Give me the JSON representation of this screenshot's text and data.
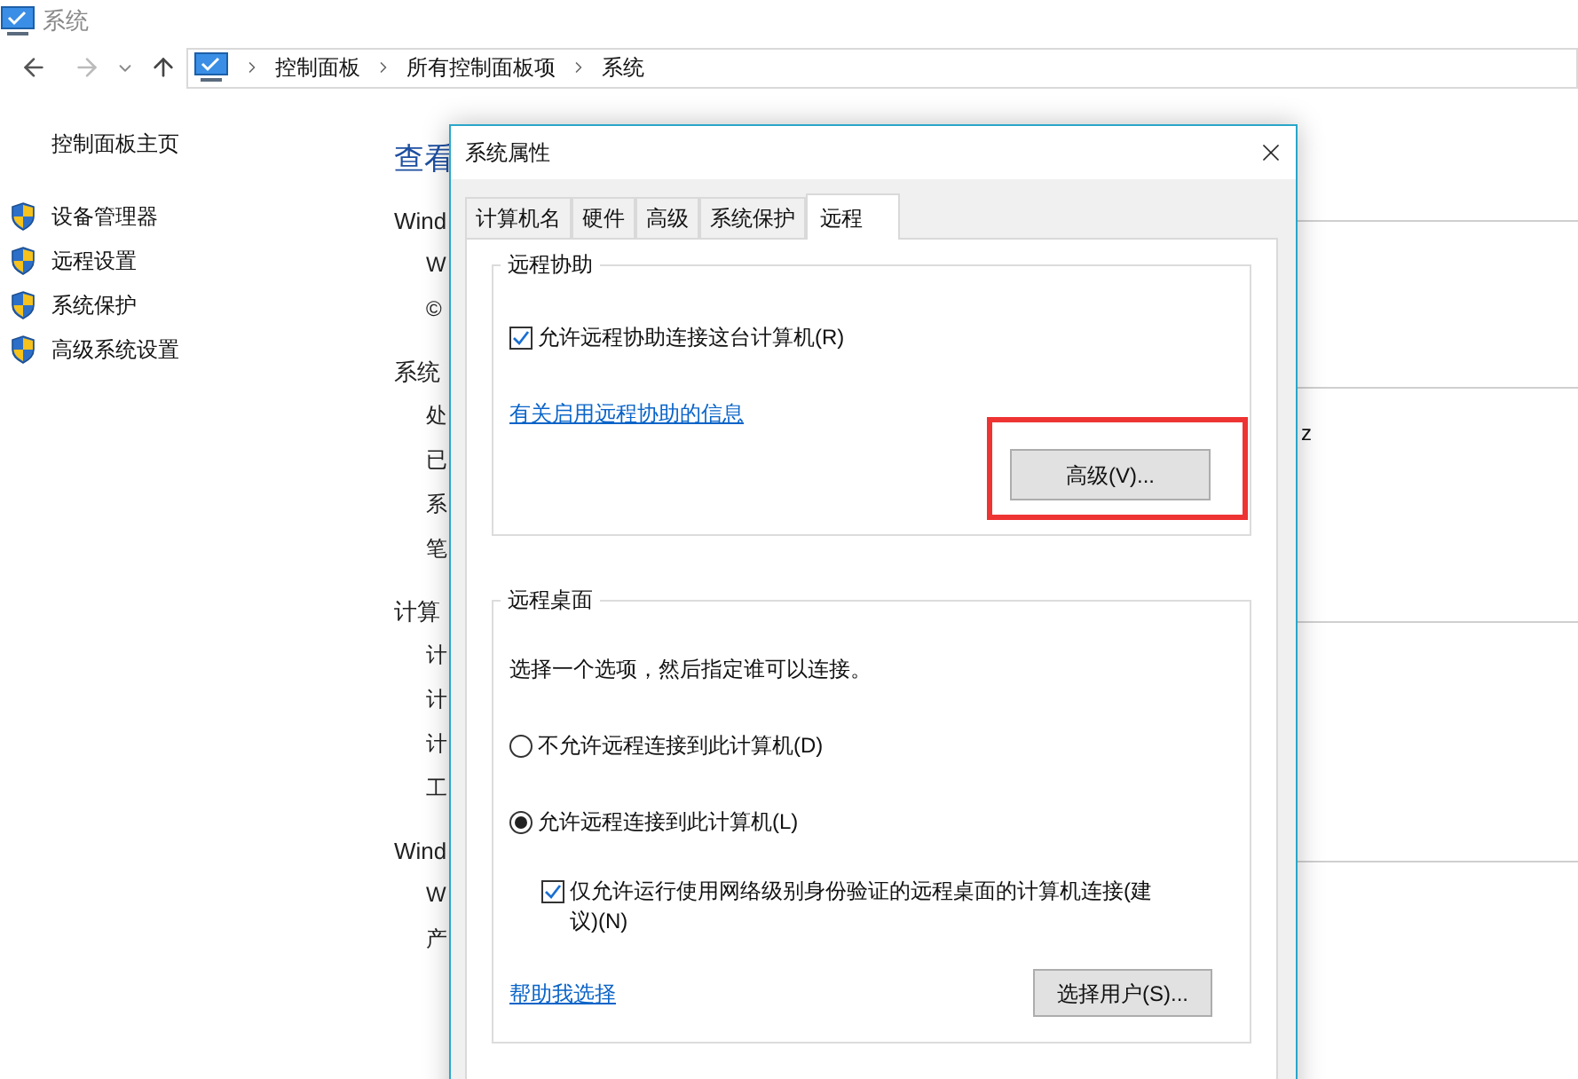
{
  "window": {
    "title": "系统"
  },
  "address_bar": {
    "breadcrumb": [
      "控制面板",
      "所有控制面板项",
      "系统"
    ]
  },
  "sidebar": {
    "home": "控制面板主页",
    "items": [
      "设备管理器",
      "远程设置",
      "系统保护",
      "高级系统设置"
    ]
  },
  "background_text": [
    {
      "text": "查看",
      "kind": "heading"
    },
    {
      "text": "Wind",
      "kind": "section"
    },
    {
      "text": "W",
      "kind": "item"
    },
    {
      "text": "©",
      "kind": "item"
    },
    {
      "text": "系统",
      "kind": "section"
    },
    {
      "text": "处",
      "kind": "item"
    },
    {
      "text": "已",
      "kind": "item"
    },
    {
      "text": "系",
      "kind": "item"
    },
    {
      "text": "笔",
      "kind": "item"
    },
    {
      "text": "计算",
      "kind": "section"
    },
    {
      "text": "计",
      "kind": "item"
    },
    {
      "text": "计",
      "kind": "item"
    },
    {
      "text": "计",
      "kind": "item"
    },
    {
      "text": "工",
      "kind": "item"
    },
    {
      "text": "Wind",
      "kind": "section"
    },
    {
      "text": "W",
      "kind": "item"
    },
    {
      "text": "产",
      "kind": "item"
    }
  ],
  "background_right_text": "z",
  "dialog": {
    "title": "系统属性",
    "tabs": [
      {
        "label": "计算机名",
        "selected": false
      },
      {
        "label": "硬件",
        "selected": false
      },
      {
        "label": "高级",
        "selected": false
      },
      {
        "label": "系统保护",
        "selected": false
      },
      {
        "label": "远程",
        "selected": true
      }
    ],
    "remote_assistance": {
      "title": "远程协助",
      "allow": {
        "label": "允许远程协助连接这台计算机(R)",
        "checked": true
      },
      "link": "有关启用远程协助的信息",
      "button": "高级(V)...",
      "highlighted": true
    },
    "remote_desktop": {
      "title": "远程桌面",
      "instruction": "选择一个选项，然后指定谁可以连接。",
      "options": [
        {
          "label": "不允许远程连接到此计算机(D)",
          "selected": false
        },
        {
          "label": "允许远程连接到此计算机(L)",
          "selected": true
        }
      ],
      "nla": {
        "label": "仅允许运行使用网络级别身份验证的远程桌面的计算机连接(建议)(N)",
        "checked": true
      },
      "link": "帮助我选择",
      "button": "选择用户(S)..."
    }
  }
}
